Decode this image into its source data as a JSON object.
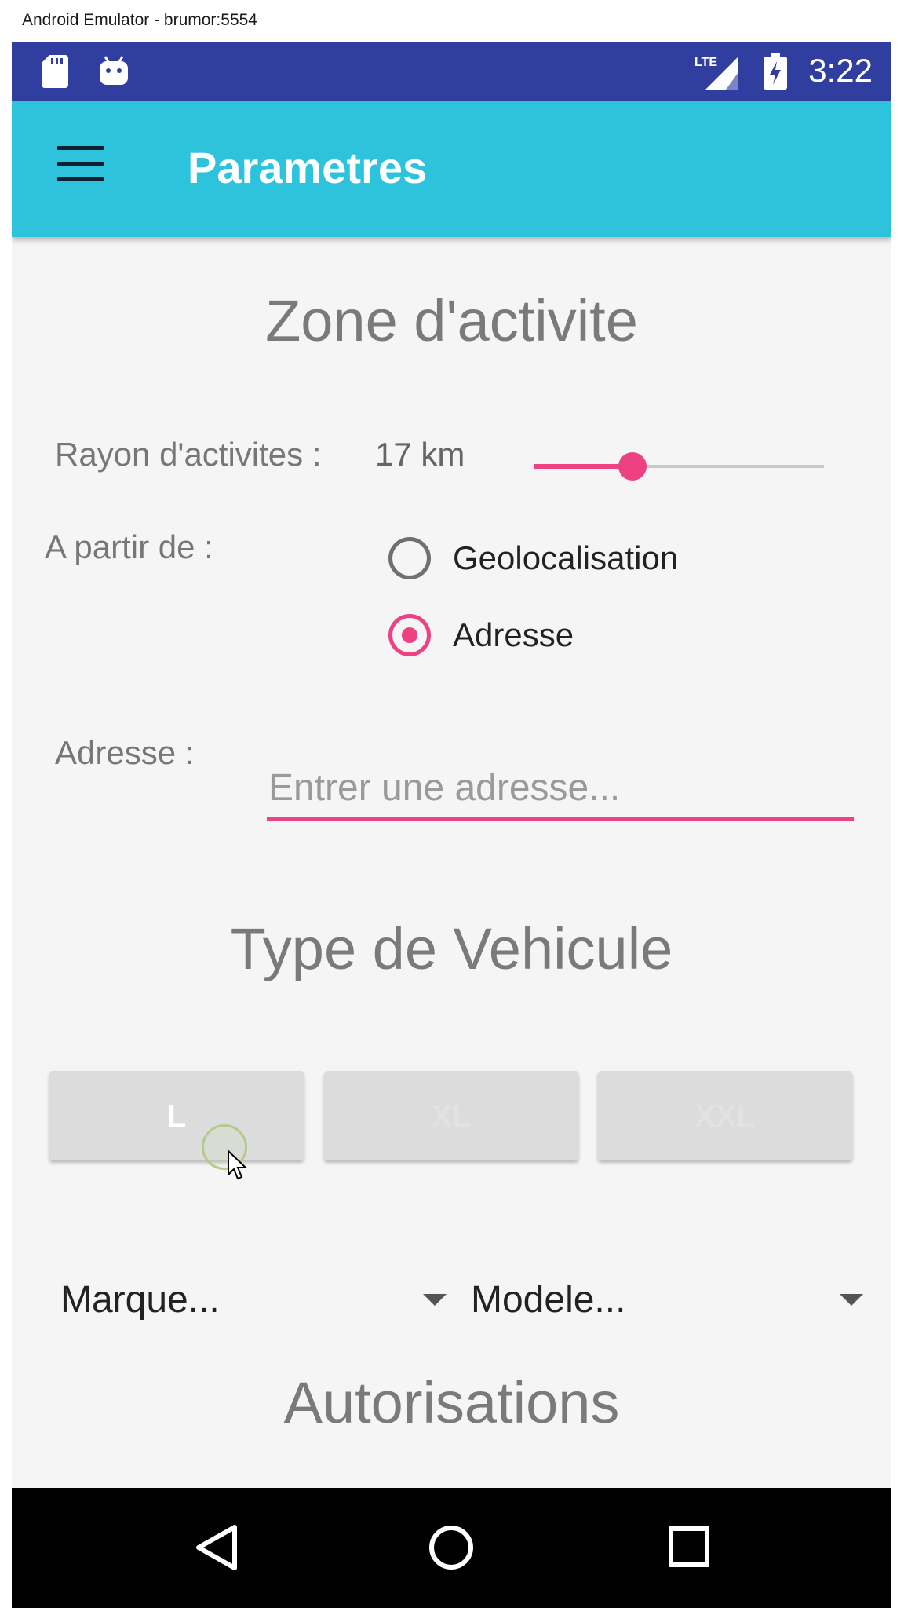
{
  "window": {
    "title": "Android Emulator - brumor:5554"
  },
  "status_bar": {
    "time": "3:22",
    "icons": [
      "sd-card-icon",
      "android-icon",
      "lte-signal-icon",
      "battery-charging-icon"
    ],
    "network_label": "LTE"
  },
  "toolbar": {
    "title": "Parametres",
    "menu_icon": "hamburger-menu-icon"
  },
  "zone": {
    "title": "Zone d'activite",
    "rayon_label": "Rayon d'activites :",
    "rayon_value": "17 km",
    "slider_fraction": 0.34,
    "apartir_label": "A partir de :",
    "options": [
      {
        "label": "Geolocalisation",
        "checked": false
      },
      {
        "label": "Adresse",
        "checked": true
      }
    ],
    "adresse_label": "Adresse :",
    "adresse_placeholder": "Entrer une adresse...",
    "adresse_value": ""
  },
  "vehicule": {
    "title": "Type de Vehicule",
    "sizes": [
      "L",
      "XL",
      "XXL"
    ],
    "marque_placeholder": "Marque...",
    "modele_placeholder": "Modele..."
  },
  "autorisations": {
    "title": "Autorisations"
  },
  "colors": {
    "accent": "#ee4184",
    "toolbar": "#2ec3dc",
    "status_bar": "#303f9f"
  },
  "nav_bar": {
    "icons": [
      "back-icon",
      "home-icon",
      "recent-apps-icon"
    ]
  }
}
